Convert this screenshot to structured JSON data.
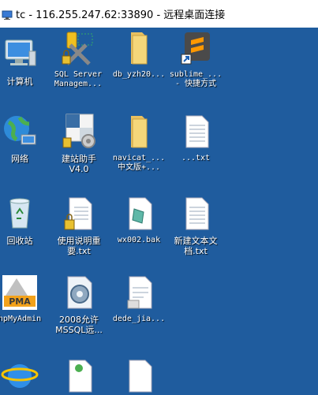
{
  "window": {
    "title": "tc - 116.255.247.62:33890 - 远程桌面连接"
  },
  "colors": {
    "desktop_bg": "#1f5c9e",
    "titlebar_bg": "#ffffff"
  },
  "desktop": {
    "icons": [
      {
        "label": "计算机",
        "icon": "computer-icon"
      },
      {
        "label": "SQL Server\nManagem...",
        "icon": "sql-server-tools-icon"
      },
      {
        "label": "db_yzh20...",
        "icon": "folder-icon"
      },
      {
        "label": "sublime_...\n- 快捷方式",
        "icon": "sublime-shortcut-icon"
      },
      {
        "label": "网络",
        "icon": "network-icon"
      },
      {
        "label": "建站助手\nV4.0",
        "icon": "site-helper-icon"
      },
      {
        "label": "navicat_...\n中文版+...",
        "icon": "folder-icon"
      },
      {
        "label": "...txt",
        "icon": "text-file-icon"
      },
      {
        "label": "回收站",
        "icon": "recycle-bin-icon"
      },
      {
        "label": "使用说明重\n要.txt",
        "icon": "locked-text-file-icon"
      },
      {
        "label": "wx002.bak",
        "icon": "bak-file-icon"
      },
      {
        "label": "新建文本文\n档.txt",
        "icon": "text-file-icon"
      },
      {
        "label": "hpMyAdmin",
        "icon": "phpmyadmin-icon"
      },
      {
        "label": "2008允许\nMSSQL远...",
        "icon": "settings-file-icon"
      },
      {
        "label": "dede_jia...",
        "icon": "document-icon"
      }
    ]
  }
}
